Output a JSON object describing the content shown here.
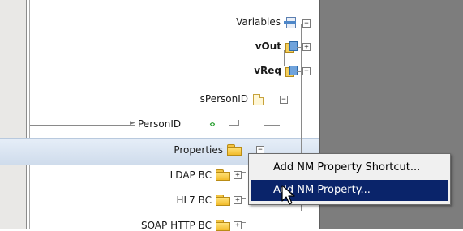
{
  "tree": {
    "variables_label": "Variables",
    "vout_label": "vOut",
    "vreq_label": "vReq",
    "spersonid_label": "sPersonID",
    "personid_label": "PersonID",
    "properties_label": "Properties",
    "ldap_label": "LDAP BC",
    "hl7_label": "HL7 BC",
    "soap_label": "SOAP HTTP BC"
  },
  "context_menu": {
    "items": [
      {
        "label": "Add NM Property Shortcut...",
        "selected": false
      },
      {
        "label": "Add NM Property...",
        "selected": true
      }
    ]
  },
  "colors": {
    "highlight_row": "#cfdcec",
    "menu_selection": "#0a246a",
    "right_panel": "#7d7d7d",
    "left_strip": "#e9e8e6"
  },
  "icons": [
    "variables-icon",
    "variable-icon",
    "part-icon",
    "mapping-arrow-icon",
    "folder-icon",
    "mouse-cursor-icon"
  ]
}
